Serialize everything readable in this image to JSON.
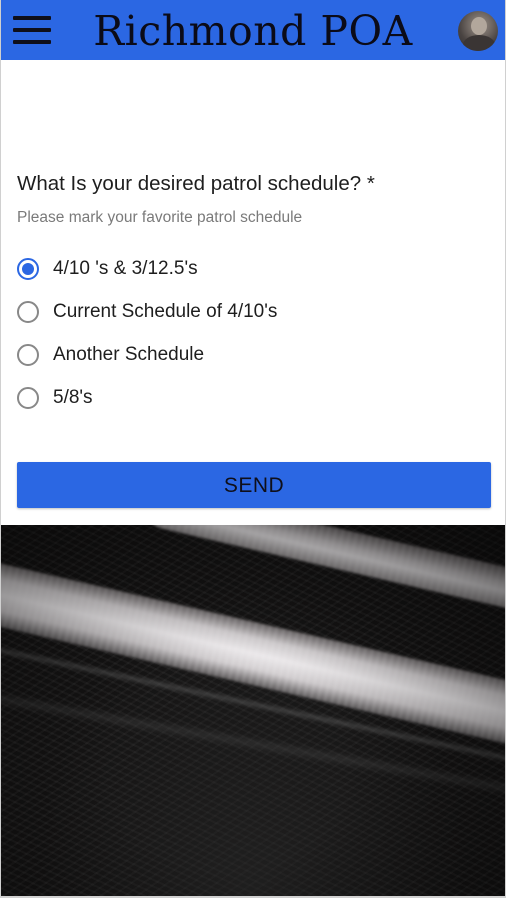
{
  "app_bar": {
    "title": "Richmond POA",
    "menu_icon": "hamburger-menu-icon",
    "avatar": "user-avatar",
    "background": "#2b67e3"
  },
  "form": {
    "question": "What Is your desired patrol schedule? *",
    "hint": "Please mark your favorite patrol schedule",
    "options": [
      {
        "label": "4/10 's & 3/12.5's",
        "selected": true
      },
      {
        "label": "Current Schedule of 4/10's",
        "selected": false
      },
      {
        "label": "Another Schedule",
        "selected": false
      },
      {
        "label": "5/8's",
        "selected": false
      }
    ],
    "send_label": "SEND"
  },
  "colors": {
    "accent": "#2b67e3",
    "text": "#1e1e1e",
    "hint": "#7a7a7a"
  }
}
